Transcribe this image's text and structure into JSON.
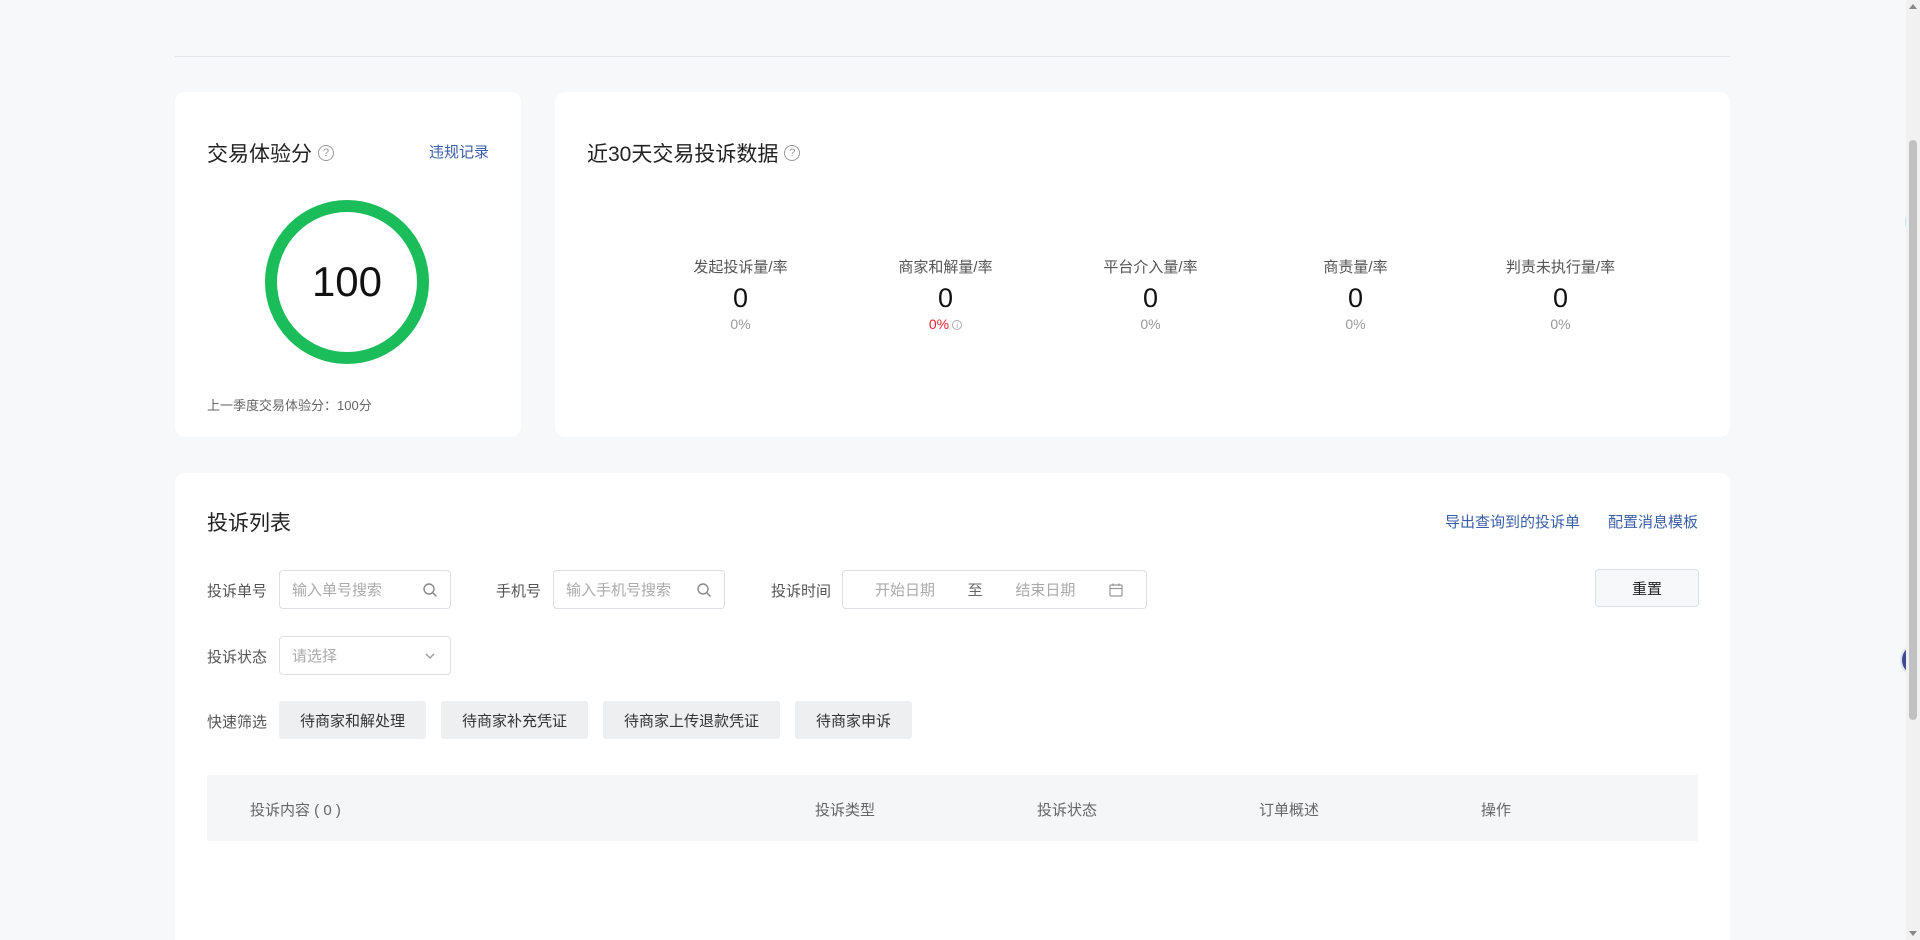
{
  "score_card": {
    "title": "交易体验分",
    "help_icon": "?",
    "violation_link": "违规记录",
    "score": "100",
    "last_quarter_text": "上一季度交易体验分：100分",
    "ring_color": "#1bbd5a"
  },
  "stats_card": {
    "title": "近30天交易投诉数据",
    "help_icon": "?",
    "items": [
      {
        "label": "发起投诉量/率",
        "value": "0",
        "rate": "0%"
      },
      {
        "label": "商家和解量/率",
        "value": "0",
        "rate": "0%"
      },
      {
        "label": "平台介入量/率",
        "value": "0",
        "rate": "0%"
      },
      {
        "label": "商责量/率",
        "value": "0",
        "rate": "0%"
      },
      {
        "label": "判责未执行量/率",
        "value": "0",
        "rate": "0%"
      }
    ]
  },
  "list_card": {
    "title": "投诉列表",
    "export_link": "导出查询到的投诉单",
    "template_link": "配置消息模板",
    "filters": {
      "order_no_label": "投诉单号",
      "order_no_placeholder": "输入单号搜索",
      "phone_label": "手机号",
      "phone_placeholder": "输入手机号搜索",
      "time_label": "投诉时间",
      "start_placeholder": "开始日期",
      "range_sep": "至",
      "end_placeholder": "结束日期",
      "status_label": "投诉状态",
      "status_placeholder": "请选择",
      "reset_button": "重置",
      "quick_label": "快速筛选",
      "quick_buttons": [
        "待商家和解处理",
        "待商家补充凭证",
        "待商家上传退款凭证",
        "待商家申诉"
      ]
    },
    "table": {
      "headers": [
        "投诉内容 ( 0 )",
        "投诉类型",
        "投诉状态",
        "订单概述",
        "操作"
      ]
    }
  }
}
